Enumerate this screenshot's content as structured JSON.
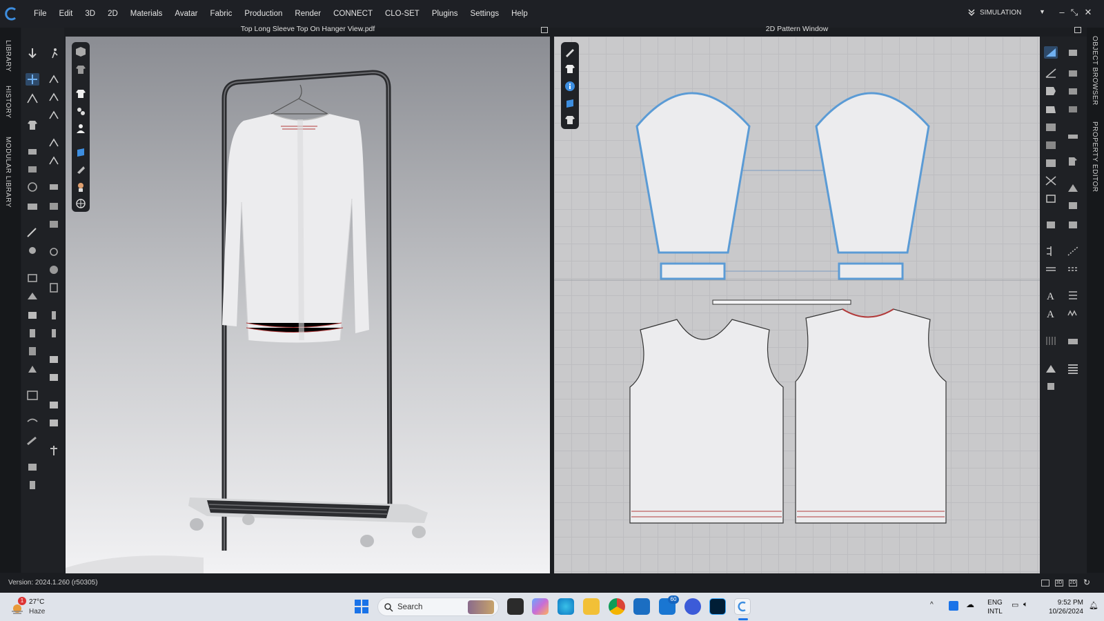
{
  "menubar": {
    "items": [
      "File",
      "Edit",
      "3D",
      "2D",
      "Materials",
      "Avatar",
      "Fabric",
      "Production",
      "Render",
      "CONNECT",
      "CLO-SET",
      "Plugins",
      "Settings",
      "Help"
    ],
    "mode": "SIMULATION"
  },
  "left_tabs": [
    "LIBRARY",
    "HISTORY",
    "MODULAR LIBRARY"
  ],
  "right_tabs": [
    "OBJECT BROWSER",
    "PROPERTY EDITOR"
  ],
  "view3d": {
    "title": "Top Long Sleeve Top On Hanger View.pdf"
  },
  "view2d": {
    "title": "2D Pattern Window"
  },
  "status": {
    "version": "Version: 2024.1.260 (r50305)",
    "view_buttons": [
      "3D",
      "2D"
    ]
  },
  "taskbar": {
    "weather_temp": "27°C",
    "weather_cond": "Haze",
    "weather_badge": "1",
    "search_placeholder": "Search",
    "mail_badge": "60",
    "lang_top": "ENG",
    "lang_bottom": "INTL",
    "time": "9:52 PM",
    "date": "10/26/2024"
  },
  "colors": {
    "accent": "#3d8ee0",
    "pattern_outline": "#5b9bd5",
    "seam_red": "#b23a3a"
  }
}
